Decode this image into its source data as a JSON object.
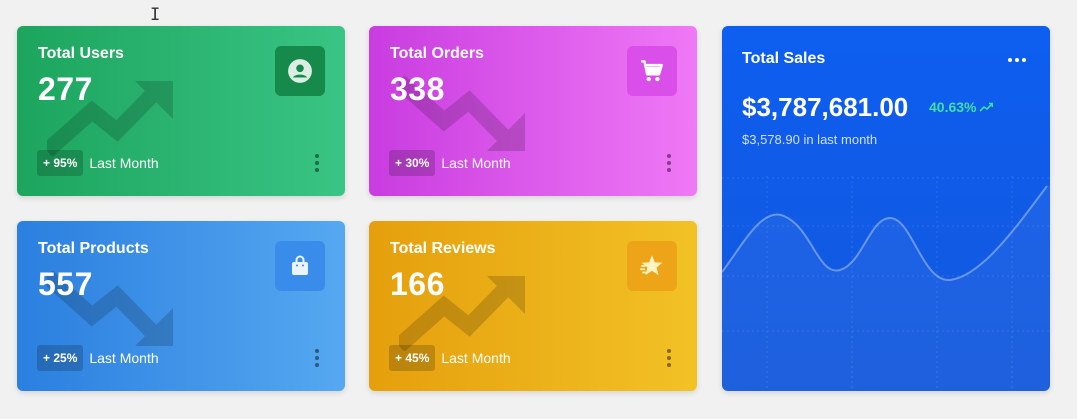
{
  "cards": [
    {
      "id": "users",
      "title": "Total Users",
      "value": "277",
      "badge": "+ 95%",
      "period": "Last Month",
      "icon": "user-circle-icon",
      "color": "#1ca55d"
    },
    {
      "id": "orders",
      "title": "Total Orders",
      "value": "338",
      "badge": "+ 30%",
      "period": "Last Month",
      "icon": "cart-icon",
      "color": "#c93ce0"
    },
    {
      "id": "products",
      "title": "Total Products",
      "value": "557",
      "badge": "+ 25%",
      "period": "Last Month",
      "icon": "shopping-bag-icon",
      "color": "#2b7fdf"
    },
    {
      "id": "reviews",
      "title": "Total Reviews",
      "value": "166",
      "badge": "+ 45%",
      "period": "Last Month",
      "icon": "star-icon",
      "color": "#e59f0d"
    }
  ],
  "sales": {
    "title": "Total Sales",
    "value": "$3,787,681.00",
    "growth": "40.63%",
    "growth_icon": "trend-up-icon",
    "subtext": "$3,578.90 in last month",
    "menu_icon": "more-horizontal-icon",
    "accent": "#0e5ef0",
    "growth_color": "#3fe0a8"
  }
}
